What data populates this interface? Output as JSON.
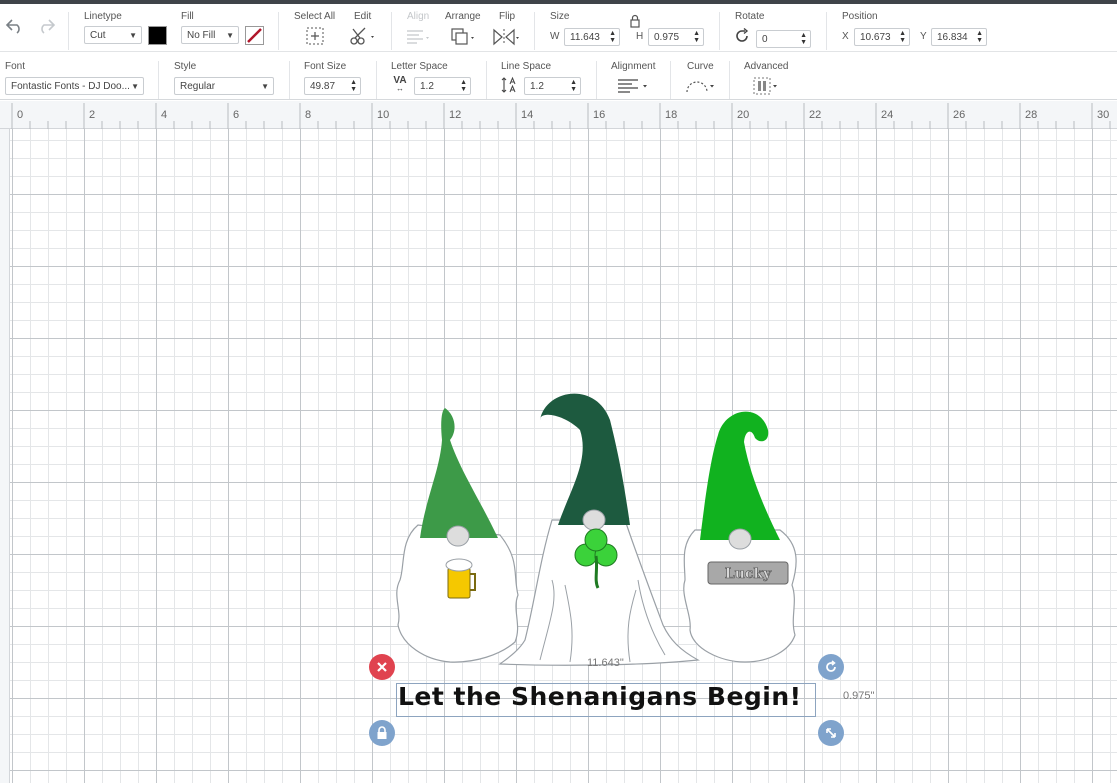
{
  "toolbar": {
    "linetype": {
      "label": "Linetype",
      "value": "Cut"
    },
    "fill": {
      "label": "Fill",
      "value": "No Fill"
    },
    "select_all": {
      "label": "Select All"
    },
    "edit": {
      "label": "Edit"
    },
    "align": {
      "label": "Align"
    },
    "arrange": {
      "label": "Arrange"
    },
    "flip": {
      "label": "Flip"
    },
    "size": {
      "label": "Size",
      "w_label": "W",
      "w_value": "11.643",
      "h_label": "H",
      "h_value": "0.975"
    },
    "rotate": {
      "label": "Rotate",
      "value": "0"
    },
    "position": {
      "label": "Position",
      "x_label": "X",
      "x_value": "10.673",
      "y_label": "Y",
      "y_value": "16.834"
    }
  },
  "text_toolbar": {
    "font": {
      "label": "Font",
      "value": "Fontastic Fonts - DJ Doo..."
    },
    "style": {
      "label": "Style",
      "value": "Regular"
    },
    "font_size": {
      "label": "Font Size",
      "value": "49.87"
    },
    "letter_space": {
      "label": "Letter Space",
      "icon_text": "VA",
      "value": "1.2"
    },
    "line_space": {
      "label": "Line Space",
      "value": "1.2"
    },
    "alignment": {
      "label": "Alignment"
    },
    "curve": {
      "label": "Curve"
    },
    "advanced": {
      "label": "Advanced"
    }
  },
  "ruler": {
    "numbers": [
      "0",
      "2",
      "4",
      "6",
      "8",
      "10",
      "12",
      "14",
      "16",
      "18",
      "20",
      "22",
      "24",
      "26",
      "28",
      "30"
    ]
  },
  "canvas": {
    "selected_text": "Let the Shenanigans Begin!",
    "width_dimension": "11.643\"",
    "height_dimension": "0.975\"",
    "sign_text": "Lucky"
  },
  "colors": {
    "gnome_left_hat": "#3d9a48",
    "gnome_middle_hat": "#1d5a3f",
    "gnome_right_hat": "#11b21f",
    "shamrock": "#3bd23a",
    "beer": "#f5c800",
    "delete_handle": "#e0434f",
    "handle_blue": "#7fa3cc"
  }
}
